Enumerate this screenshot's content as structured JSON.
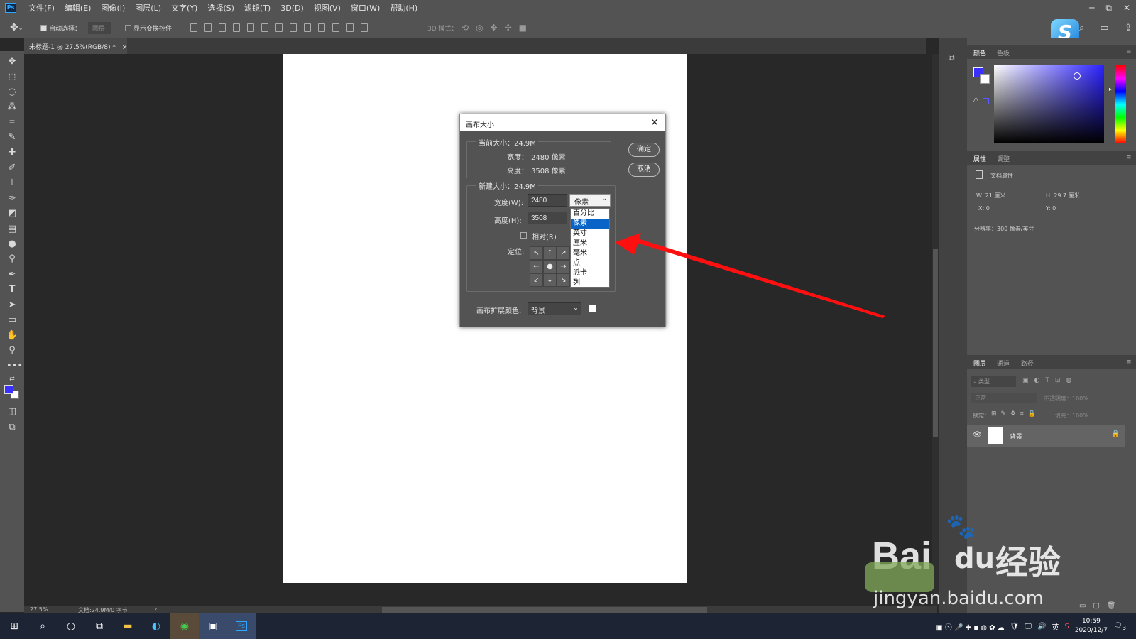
{
  "app": {
    "logo": "Ps",
    "menu": [
      "文件(F)",
      "编辑(E)",
      "图像(I)",
      "图层(L)",
      "文字(Y)",
      "选择(S)",
      "滤镜(T)",
      "3D(D)",
      "视图(V)",
      "窗口(W)",
      "帮助(H)"
    ],
    "window_controls": [
      "─",
      "⧉",
      "✕"
    ]
  },
  "options": {
    "auto_select_label": "自动选择：",
    "auto_select_target": "图层",
    "show_transform": "显示变换控件",
    "mode_3d": "3D 模式："
  },
  "document_tab": {
    "title": "未标题-1 @ 27.5%(RGB/8) *",
    "close": "×"
  },
  "status": {
    "zoom": "27.5%",
    "doc_info": "文档:24.9M/0 字节"
  },
  "panels": {
    "color_tabs": [
      "颜色",
      "色板"
    ],
    "props_tabs": [
      "属性",
      "调整"
    ],
    "props_title": "文档属性",
    "w": "W:  21 厘米",
    "h": "H:  29.7 厘米",
    "x": "X:  0",
    "y": "Y:  0",
    "resolution": "分辨率：300 像素/英寸",
    "layers_tabs": [
      "图层",
      "通道",
      "路径"
    ],
    "layer_kind": "类型",
    "blend_mode": "正常",
    "opacity": "不透明度：100%",
    "lock": "锁定：",
    "fill": "填充：100%",
    "layer_name": "背景"
  },
  "dialog": {
    "title": "画布大小",
    "current_size": "当前大小：24.9M",
    "cur_width_label": "宽度：",
    "cur_width": "2480 像素",
    "cur_height_label": "高度：",
    "cur_height": "3508 像素",
    "new_size": "新建大小：24.9M",
    "width_label": "宽度(W):",
    "width_value": "2480",
    "height_label": "高度(H):",
    "height_value": "3508",
    "unit_selected": "像素",
    "unit_options": [
      "百分比",
      "像素",
      "英寸",
      "厘米",
      "毫米",
      "点",
      "派卡",
      "列"
    ],
    "relative_label": "相对(R)",
    "anchor_label": "定位:",
    "ok": "确定",
    "cancel": "取消",
    "ext_color_label": "画布扩展颜色:",
    "ext_color": "背景"
  },
  "taskbar": {
    "time": "10:59",
    "date": "2020/12/7",
    "ime": "英",
    "notif_count": "3"
  },
  "watermark": {
    "brand": "Bai",
    "paw": "du",
    "cn": "经验",
    "url": "jingyan.baidu.com"
  },
  "colors": {
    "foreground": "#3a30ff",
    "arrow": "#ff1010",
    "selection": "#0a64c8"
  }
}
